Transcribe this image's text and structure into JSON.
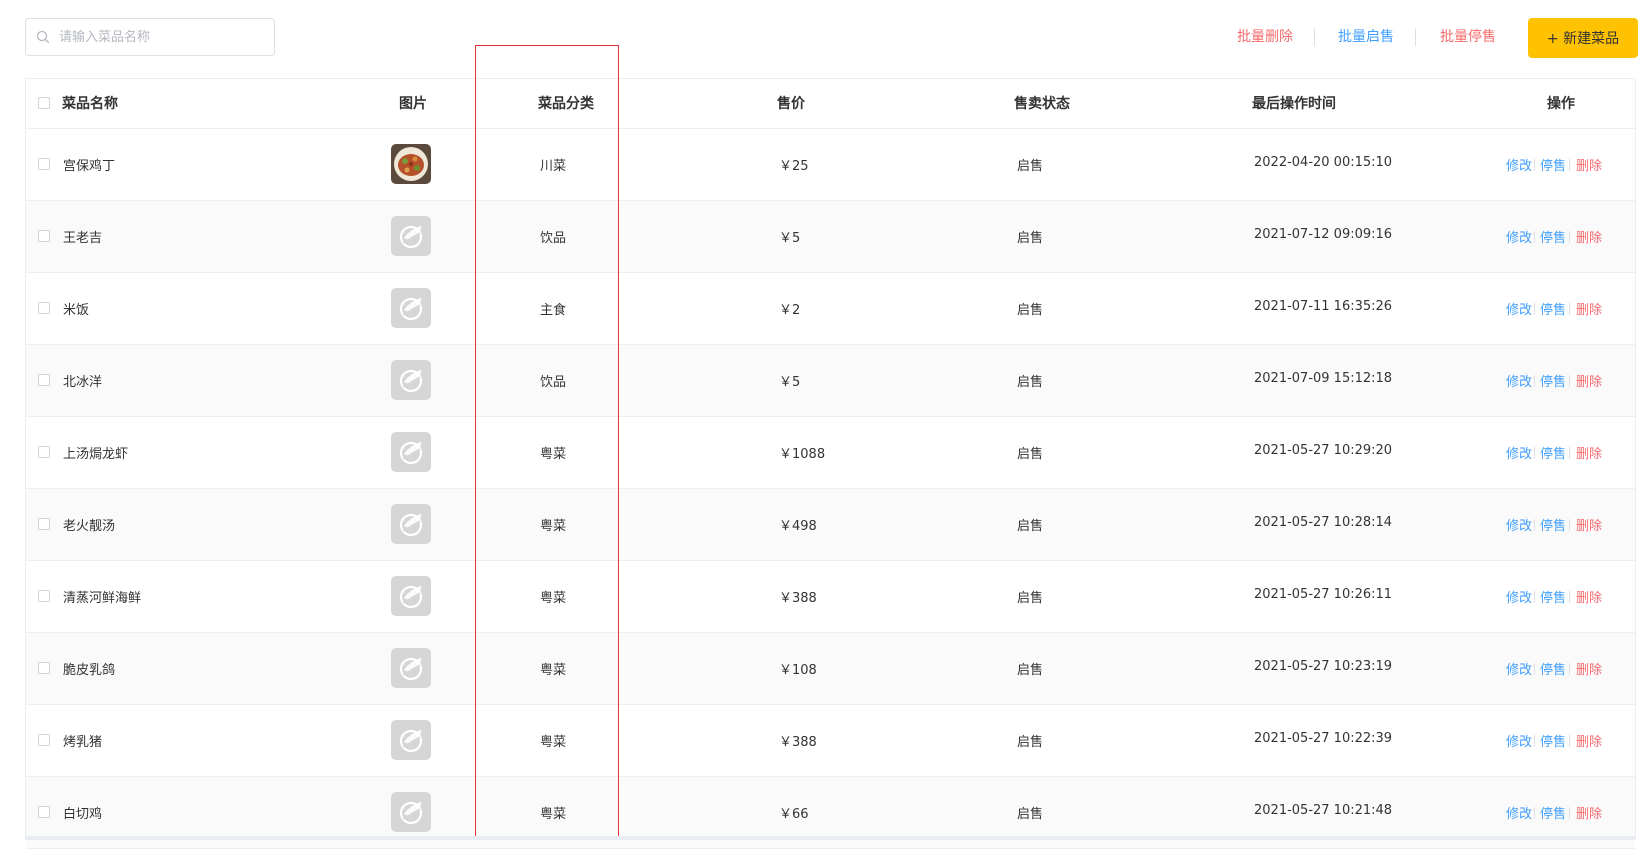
{
  "search": {
    "placeholder": "请输入菜品名称"
  },
  "toolbar": {
    "batch_delete": "批量删除",
    "batch_enable": "批量启售",
    "batch_disable": "批量停售",
    "new_dish": "+ 新建菜品"
  },
  "colors": {
    "primary": "#ffc200",
    "link_blue": "#409eff",
    "danger_red": "#f56c6c",
    "highlight_box": "#e5343b"
  },
  "table": {
    "headers": {
      "name": "菜品名称",
      "image": "图片",
      "category": "菜品分类",
      "price": "售价",
      "status": "售卖状态",
      "updated": "最后操作时间",
      "ops": "操作"
    },
    "op_labels": {
      "edit": "修改",
      "toggle": "停售",
      "delete": "删除"
    },
    "rows": [
      {
        "name": "宫保鸡丁",
        "image": "food-photo",
        "category": "川菜",
        "price": "￥25",
        "status": "启售",
        "updated": "2022-04-20 00:15:10"
      },
      {
        "name": "王老吉",
        "image": "placeholder-logo-icon",
        "category": "饮品",
        "price": "￥5",
        "status": "启售",
        "updated": "2021-07-12 09:09:16"
      },
      {
        "name": "米饭",
        "image": "placeholder-logo-icon",
        "category": "主食",
        "price": "￥2",
        "status": "启售",
        "updated": "2021-07-11 16:35:26"
      },
      {
        "name": "北冰洋",
        "image": "placeholder-logo-icon",
        "category": "饮品",
        "price": "￥5",
        "status": "启售",
        "updated": "2021-07-09 15:12:18"
      },
      {
        "name": "上汤焗龙虾",
        "image": "placeholder-logo-icon",
        "category": "粤菜",
        "price": "￥1088",
        "status": "启售",
        "updated": "2021-05-27 10:29:20"
      },
      {
        "name": "老火靓汤",
        "image": "placeholder-logo-icon",
        "category": "粤菜",
        "price": "￥498",
        "status": "启售",
        "updated": "2021-05-27 10:28:14"
      },
      {
        "name": "清蒸河鲜海鲜",
        "image": "placeholder-logo-icon",
        "category": "粤菜",
        "price": "￥388",
        "status": "启售",
        "updated": "2021-05-27 10:26:11"
      },
      {
        "name": "脆皮乳鸽",
        "image": "placeholder-logo-icon",
        "category": "粤菜",
        "price": "￥108",
        "status": "启售",
        "updated": "2021-05-27 10:23:19"
      },
      {
        "name": "烤乳猪",
        "image": "placeholder-logo-icon",
        "category": "粤菜",
        "price": "￥388",
        "status": "启售",
        "updated": "2021-05-27 10:22:39"
      },
      {
        "name": "白切鸡",
        "image": "placeholder-logo-icon",
        "category": "粤菜",
        "price": "￥66",
        "status": "启售",
        "updated": "2021-05-27 10:21:48"
      }
    ]
  }
}
